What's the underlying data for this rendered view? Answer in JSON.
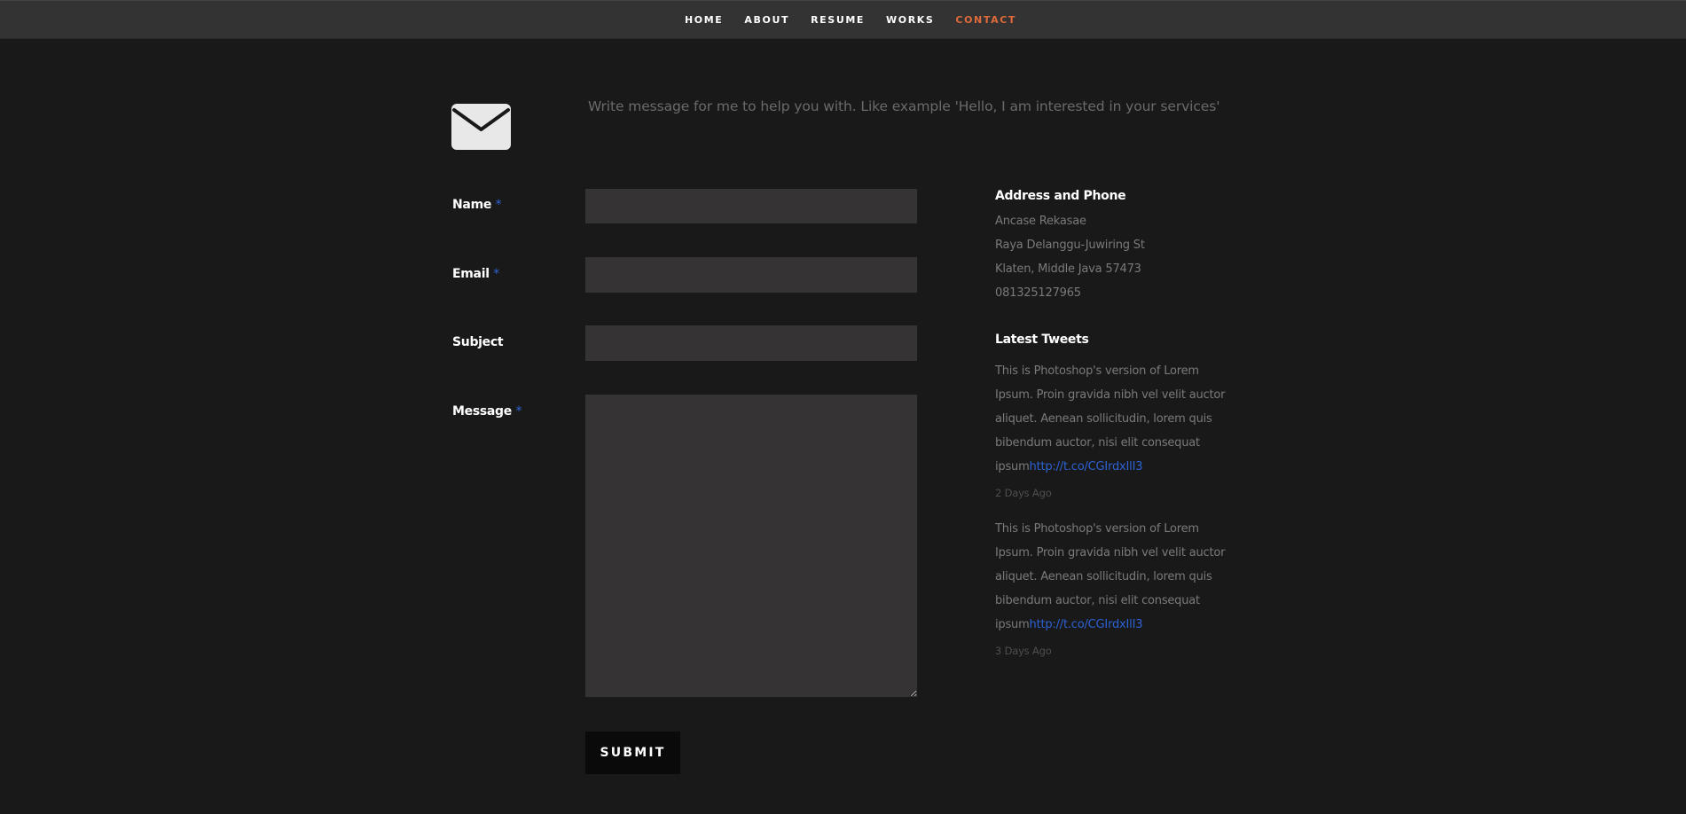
{
  "nav": {
    "items": [
      {
        "label": "HOME",
        "active": false
      },
      {
        "label": "ABOUT",
        "active": false
      },
      {
        "label": "RESUME",
        "active": false
      },
      {
        "label": "WORKS",
        "active": false
      },
      {
        "label": "CONTACT",
        "active": true
      }
    ],
    "active_color": "#e06a3a"
  },
  "contact": {
    "icon": "envelope-icon",
    "intro": "Write message for me to help you with. Like example 'Hello, I am interested in your services'"
  },
  "form": {
    "name_label": "Name",
    "email_label": "Email",
    "subject_label": "Subject",
    "message_label": "Message",
    "required_mark": "*",
    "name_value": "",
    "email_value": "",
    "subject_value": "",
    "message_value": "",
    "submit_label": "SUBMIT"
  },
  "address": {
    "heading": "Address and Phone",
    "lines": [
      "Ancase Rekasae",
      "Raya Delanggu-Juwiring St",
      "Klaten, Middle Java 57473",
      "081325127965"
    ]
  },
  "tweets": {
    "heading": "Latest Tweets",
    "items": [
      {
        "text": "This is Photoshop's version of Lorem Ipsum. Proin gravida nibh vel velit auctor aliquet. Aenean sollicitudin, lorem quis bibendum auctor, nisi elit consequat ipsum",
        "link": "http://t.co/CGIrdxIlI3",
        "time": "2 Days Ago"
      },
      {
        "text": "This is Photoshop's version of Lorem Ipsum. Proin gravida nibh vel velit auctor aliquet. Aenean sollicitudin, lorem quis bibendum auctor, nisi elit consequat ipsum",
        "link": "http://t.co/CGIrdxIlI3",
        "time": "3 Days Ago"
      }
    ]
  },
  "colors": {
    "background": "#191919",
    "navbar": "#333333",
    "field": "#363334",
    "link": "#2d62d4",
    "required": "#2f63d6",
    "button": "#0a0a0a"
  }
}
